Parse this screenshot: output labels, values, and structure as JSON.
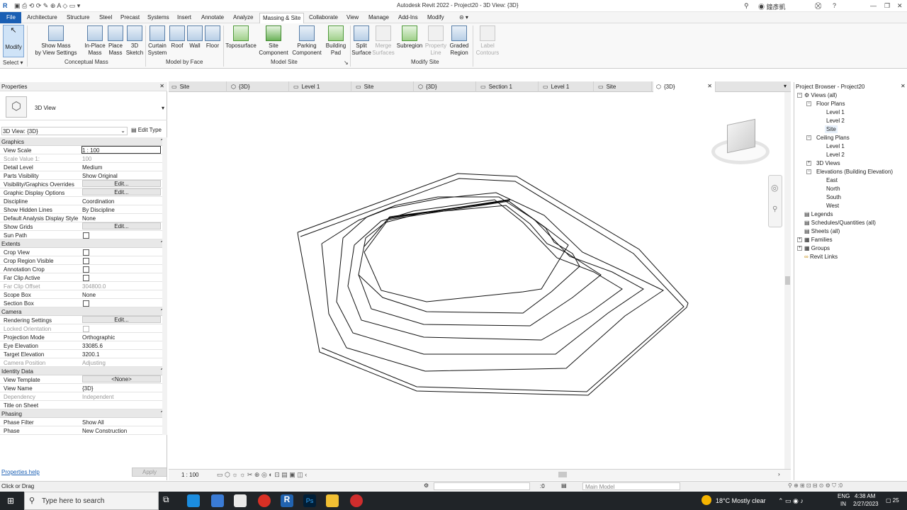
{
  "window": {
    "title": "Autodesk Revit 2022 - Project20 - 3D View: {3D}",
    "user": "鐘彥凱"
  },
  "menu": {
    "file": "File",
    "tabs": [
      "Architecture",
      "Structure",
      "Steel",
      "Precast",
      "Systems",
      "Insert",
      "Annotate",
      "Analyze",
      "Massing & Site",
      "Collaborate",
      "View",
      "Manage",
      "Add-Ins",
      "Modify"
    ],
    "active": "Massing & Site"
  },
  "ribbon": {
    "modify": "Modify",
    "select": "Select",
    "buttons": {
      "show_mass": "Show Mass\nby View Settings",
      "inplace_mass": "In-Place\nMass",
      "place_mass": "Place\nMass",
      "sketch3d": "3D\nSketch",
      "curtain": "Curtain\nSystem",
      "roof": "Roof",
      "wall": "Wall",
      "floor": "Floor",
      "toposurface": "Toposurface",
      "site_component": "Site\nComponent",
      "parking": "Parking\nComponent",
      "building_pad": "Building\nPad",
      "split_surface": "Split\nSurface",
      "merge_surfaces": "Merge\nSurfaces",
      "subregion": "Subregion",
      "property_line": "Property\nLine",
      "graded_region": "Graded\nRegion",
      "label_contours": "Label\nContours"
    },
    "panels": {
      "conceptual": "Conceptual Mass",
      "model_by_face": "Model by Face",
      "model_site": "Model Site",
      "modify_site": "Modify Site"
    }
  },
  "properties": {
    "header": "Properties",
    "type": "3D View",
    "instance": "3D View: {3D}",
    "edit_type": "Edit Type",
    "help": "Properties help",
    "apply": "Apply",
    "sections": {
      "graphics": "Graphics",
      "extents": "Extents",
      "camera": "Camera",
      "identity": "Identity Data",
      "phasing": "Phasing"
    },
    "rows": {
      "view_scale_k": "View Scale",
      "view_scale_v": "1 : 100",
      "scale_value_k": "Scale Value    1:",
      "scale_value_v": "100",
      "detail_level_k": "Detail Level",
      "detail_level_v": "Medium",
      "parts_vis_k": "Parts Visibility",
      "parts_vis_v": "Show Original",
      "vg_over_k": "Visibility/Graphics Overrides",
      "edit": "Edit...",
      "gdo_k": "Graphic Display Options",
      "discipline_k": "Discipline",
      "discipline_v": "Coordination",
      "hidden_k": "Show Hidden Lines",
      "hidden_v": "By Discipline",
      "dads_k": "Default Analysis Display Style",
      "dads_v": "None",
      "grids_k": "Show Grids",
      "sunpath_k": "Sun Path",
      "crop_k": "Crop View",
      "crop_reg_k": "Crop Region Visible",
      "ann_crop_k": "Annotation Crop",
      "farclip_k": "Far Clip Active",
      "farclip_off_k": "Far Clip Offset",
      "farclip_off_v": "304800.0",
      "scope_k": "Scope Box",
      "scope_v": "None",
      "section_k": "Section Box",
      "render_k": "Rendering Settings",
      "locked_k": "Locked Orientation",
      "proj_k": "Projection Mode",
      "proj_v": "Orthographic",
      "eye_k": "Eye Elevation",
      "eye_v": "33085.6",
      "target_k": "Target Elevation",
      "target_v": "3200.1",
      "campos_k": "Camera Position",
      "campos_v": "Adjusting",
      "vtemp_k": "View Template",
      "vtemp_v": "<None>",
      "vname_k": "View Name",
      "vname_v": "{3D}",
      "dep_k": "Dependency",
      "dep_v": "Independent",
      "title_k": "Title on Sheet",
      "pfilter_k": "Phase Filter",
      "pfilter_v": "Show All",
      "phase_k": "Phase",
      "phase_v": "New Construction"
    }
  },
  "view_tabs": [
    "Site",
    "{3D}",
    "Level 1",
    "Site",
    "{3D}",
    "Section 1",
    "Level 1",
    "Site",
    "{3D}"
  ],
  "viewbar": {
    "scale": "1 : 100"
  },
  "browser": {
    "header": "Project Browser - Project20",
    "items": [
      "Views (all)",
      "Floor Plans",
      "Level 1",
      "Level 2",
      "Site",
      "Ceiling Plans",
      "Level 1",
      "Level 2",
      "3D Views",
      "Elevations (Building Elevation)",
      "East",
      "North",
      "South",
      "West",
      "Legends",
      "Schedules/Quantities (all)",
      "Sheets (all)",
      "Families",
      "Groups",
      "Revit Links"
    ]
  },
  "status": {
    "text": "Click or Drag",
    "workset": ":0",
    "model": "Main Model"
  },
  "taskbar": {
    "search": "Type here to search",
    "weather": "18°C  Mostly clear",
    "lang1": "ENG",
    "lang2": "IN",
    "time": "4:38 AM",
    "date": "2/27/2023",
    "notif": "25"
  }
}
